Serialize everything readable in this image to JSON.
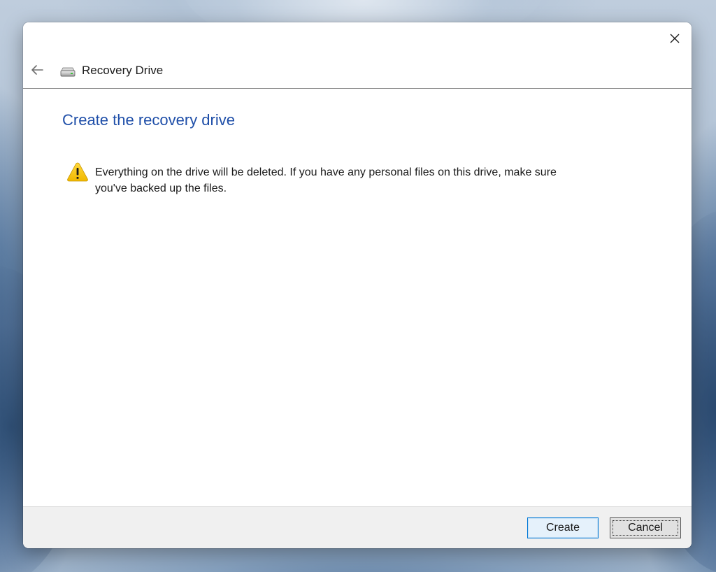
{
  "window": {
    "close_icon": "close-icon"
  },
  "navbar": {
    "back_icon": "back-arrow-icon",
    "app_icon": "drive-icon",
    "title": "Recovery Drive"
  },
  "content": {
    "heading": "Create the recovery drive",
    "warning_icon": "warning-icon",
    "warning_color": "#f5c400",
    "warning_text": "Everything on the drive will be deleted. If you have any personal files on this drive, make sure you've backed up the files."
  },
  "footer": {
    "create_label": "Create",
    "cancel_label": "Cancel"
  },
  "colors": {
    "heading": "#1e4ea8",
    "default_button_border": "#0078d7"
  }
}
